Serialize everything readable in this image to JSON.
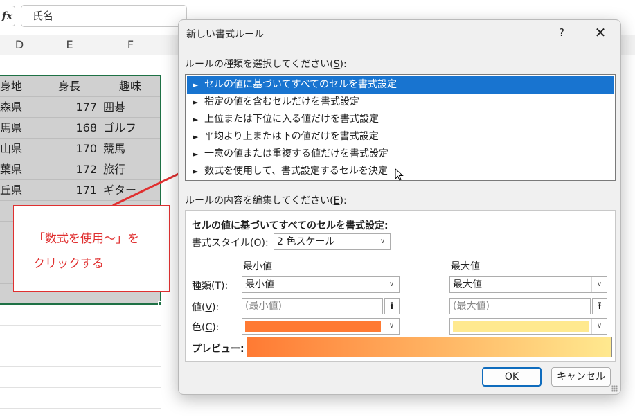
{
  "excel": {
    "fx_label": "fx",
    "formula_value": "氏名",
    "columns": [
      "D",
      "E",
      "F"
    ],
    "rows": [
      [
        "身地",
        "身長",
        "趣味"
      ],
      [
        "森県",
        "177",
        "囲碁"
      ],
      [
        "馬県",
        "168",
        "ゴルフ"
      ],
      [
        "山県",
        "170",
        "競馬"
      ],
      [
        "葉県",
        "172",
        "旅行"
      ],
      [
        "丘県",
        "171",
        "ギター"
      ]
    ]
  },
  "callout": {
    "line1": "「数式を使用～」を",
    "line2": "クリックする",
    "color": "#e03030"
  },
  "dialog": {
    "title": "新しい書式ルール",
    "help": "?",
    "close": "✕",
    "rule_type_label": "ルールの種類を選択してください(",
    "rule_type_key": "S",
    "rule_type_suffix": "):",
    "rule_types": [
      "セルの値に基づいてすべてのセルを書式設定",
      "指定の値を含むセルだけを書式設定",
      "上位または下位に入る値だけを書式設定",
      "平均より上または下の値だけを書式設定",
      "一意の値または重複する値だけを書式設定",
      "数式を使用して、書式設定するセルを決定"
    ],
    "selected_rule_index": 0,
    "edit_label": "ルールの内容を編集してください(",
    "edit_key": "E",
    "edit_suffix": "):",
    "panel_heading": "セルの値に基づいてすべてのセルを書式設定:",
    "style_label": "書式スタイル(",
    "style_key": "O",
    "style_suffix": "):",
    "style_value": "2 色スケール",
    "min_header": "最小値",
    "max_header": "最大値",
    "type_label": "種類(",
    "type_key": "T",
    "type_suffix": "):",
    "min_type": "最小値",
    "max_type": "最大値",
    "value_label": "値(",
    "value_key": "V",
    "value_suffix": "):",
    "min_value_placeholder": "(最小値)",
    "max_value_placeholder": "(最大値)",
    "color_label": "色(",
    "color_key": "C",
    "color_suffix": "):",
    "min_color": "#ff7a33",
    "max_color": "#ffe98f",
    "preview_label": "プレビュー:",
    "ok": "OK",
    "cancel": "キャンセル"
  }
}
